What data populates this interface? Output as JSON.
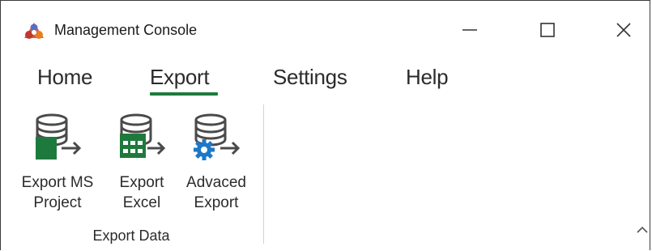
{
  "window": {
    "title": "Management Console",
    "app_icon": "app-logo-icon",
    "controls": {
      "minimize": "minimize-icon",
      "maximize": "maximize-icon",
      "close": "close-icon"
    }
  },
  "menu": {
    "tabs": [
      {
        "label": "Home",
        "active": false
      },
      {
        "label": "Export",
        "active": true
      },
      {
        "label": "Settings",
        "active": false
      },
      {
        "label": "Help",
        "active": false
      }
    ],
    "active_color": "#1e7a3c"
  },
  "ribbon": {
    "group_label": "Export Data",
    "buttons": [
      {
        "label": "Export MS\nProject",
        "icon": "export-ms-project-icon"
      },
      {
        "label": "Export\nExcel",
        "icon": "export-excel-icon"
      },
      {
        "label": "Advaced\nExport",
        "icon": "advanced-export-icon"
      }
    ],
    "collapse_icon": "chevron-up-icon"
  },
  "colors": {
    "accent_green": "#1e7a3c",
    "icon_gray": "#5a5a5a",
    "icon_blue": "#1e78c8"
  }
}
